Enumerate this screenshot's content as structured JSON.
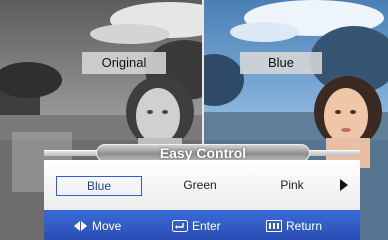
{
  "comparison": {
    "left_label": "Original",
    "right_label": "Blue"
  },
  "osd": {
    "title": "Easy Control",
    "options": [
      "Blue",
      "Green",
      "Pink"
    ],
    "selected_option": "Blue"
  },
  "footer": {
    "move_label": "Move",
    "enter_label": "Enter",
    "return_label": "Return"
  },
  "icons": {
    "move": "left-right-arrows-icon",
    "enter": "enter-icon",
    "return": "menu-return-icon",
    "next": "next-arrow-icon"
  },
  "colors": {
    "selection_border": "#2d5fcf",
    "footer_bg": "#2a4eb4"
  }
}
